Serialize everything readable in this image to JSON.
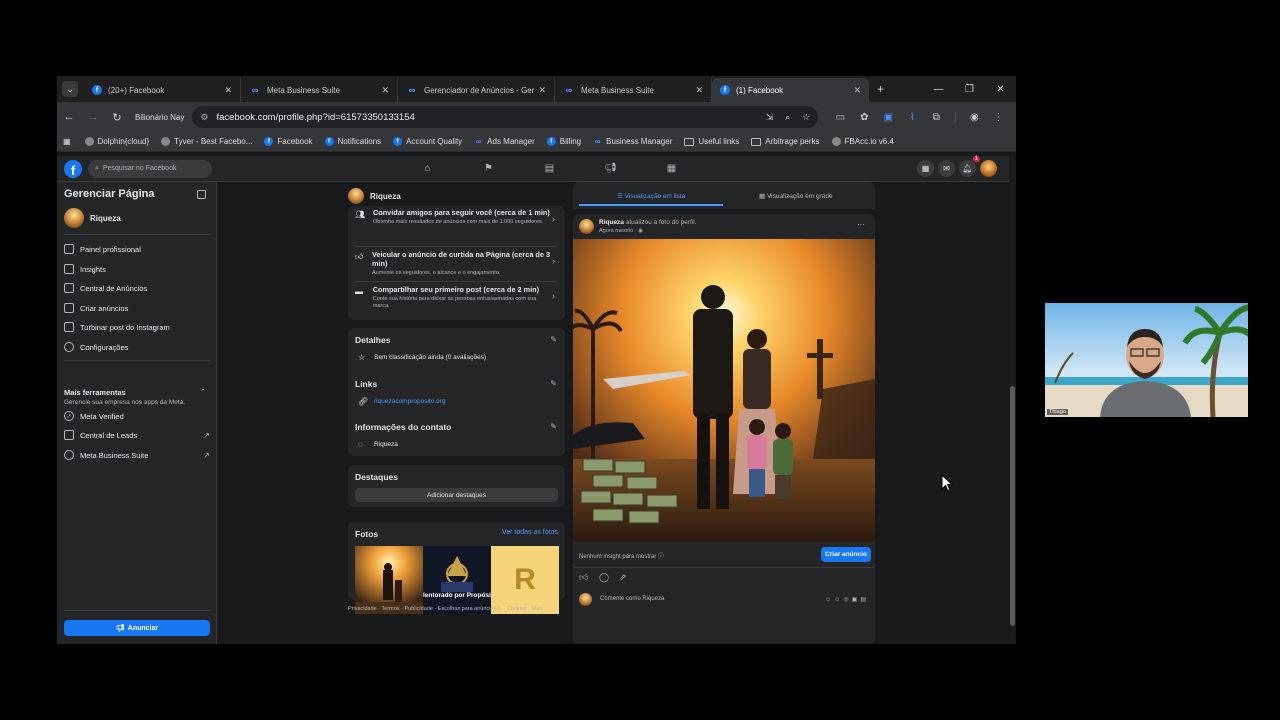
{
  "browser": {
    "tabs": [
      {
        "title": "(20+) Facebook",
        "icon": "facebook-icon"
      },
      {
        "title": "Meta Business Suite",
        "icon": "meta-icon"
      },
      {
        "title": "Gerenciador de Anúncios - Ger",
        "icon": "meta-icon"
      },
      {
        "title": "Meta Business Suite",
        "icon": "meta-icon"
      },
      {
        "title": "(1) Facebook",
        "icon": "facebook-icon"
      }
    ],
    "profile_name": "Bilionário Nay",
    "url": "facebook.com/profile.php?id=61573350133154",
    "bookmarks": [
      {
        "label": "Dolphin{cloud}"
      },
      {
        "label": "Tyver - Best Facebo..."
      },
      {
        "label": "Facebook"
      },
      {
        "label": "Notifications"
      },
      {
        "label": "Account Quality"
      },
      {
        "label": "Ads Manager"
      },
      {
        "label": "Billing"
      },
      {
        "label": "Business Manager"
      },
      {
        "label": "Useful links"
      },
      {
        "label": "Arbitrage perks"
      },
      {
        "label": "FBAcc.io v6.4"
      }
    ]
  },
  "fb": {
    "search_placeholder": "Pesquisar no Facebook",
    "notification_count": "1"
  },
  "sidebar": {
    "title": "Gerenciar Página",
    "page_name": "Riqueza",
    "items": [
      {
        "label": "Painel profissional"
      },
      {
        "label": "Insights"
      },
      {
        "label": "Central de Anúncios"
      },
      {
        "label": "Criar anúncios"
      },
      {
        "label": "Turbinar post do Instagram"
      },
      {
        "label": "Configurações"
      }
    ],
    "more_tools_title": "Mais ferramentas",
    "more_tools_sub": "Gerencie sua empresa nos apps da Meta.",
    "tools": [
      {
        "label": "Meta Verified"
      },
      {
        "label": "Central de Leads"
      },
      {
        "label": "Meta Business Suite"
      }
    ],
    "anunciar": "Anunciar"
  },
  "page": {
    "name": "Riqueza",
    "tasks": [
      {
        "title": "Convidar amigos para seguir você (cerca de 1 min)",
        "sub": "Obtenha mais resultados de anúncios com mais de 1.000 seguidores."
      },
      {
        "title": "Veicular o anúncio de curtida na Página (cerca de 3 min)",
        "sub": "Aumente os seguidores, o alcance e o engajamento."
      },
      {
        "title": "Compartilhar seu primeiro post (cerca de 2 min)",
        "sub": "Conte sua história para deixar as pessoas entusiasmadas com sua marca."
      }
    ],
    "details_title": "Detalhes",
    "rating": "Sem classificação ainda (0 avaliações)",
    "links_title": "Links",
    "link": "riquezacomproposito.org",
    "contact_title": "Informações do contato",
    "contact": "Riqueza",
    "highlights_title": "Destaques",
    "add_highlights": "Adicionar destaques",
    "photos_title": "Fotos",
    "see_all_photos": "Ver todas as fotos",
    "photo2_text": "lentorado por Propósit",
    "photo3_text": "R",
    "footer": "Privacidade · Termos · Publicidade · Escolhas para anúncios ▷ · Cookies · Mais"
  },
  "feed": {
    "list_view": "Visualização em lista",
    "grid_view": "Visualização em grade",
    "post_author": "Riqueza",
    "post_action": " atualizou a foto do perfil.",
    "post_time": "Agora mesmo · ",
    "no_insight": "Nenhum insight para mostrar",
    "create_ad": "Criar anúncio",
    "comment_placeholder": "Comente como Riqueza"
  },
  "webcam": {
    "name": "Thiago"
  }
}
